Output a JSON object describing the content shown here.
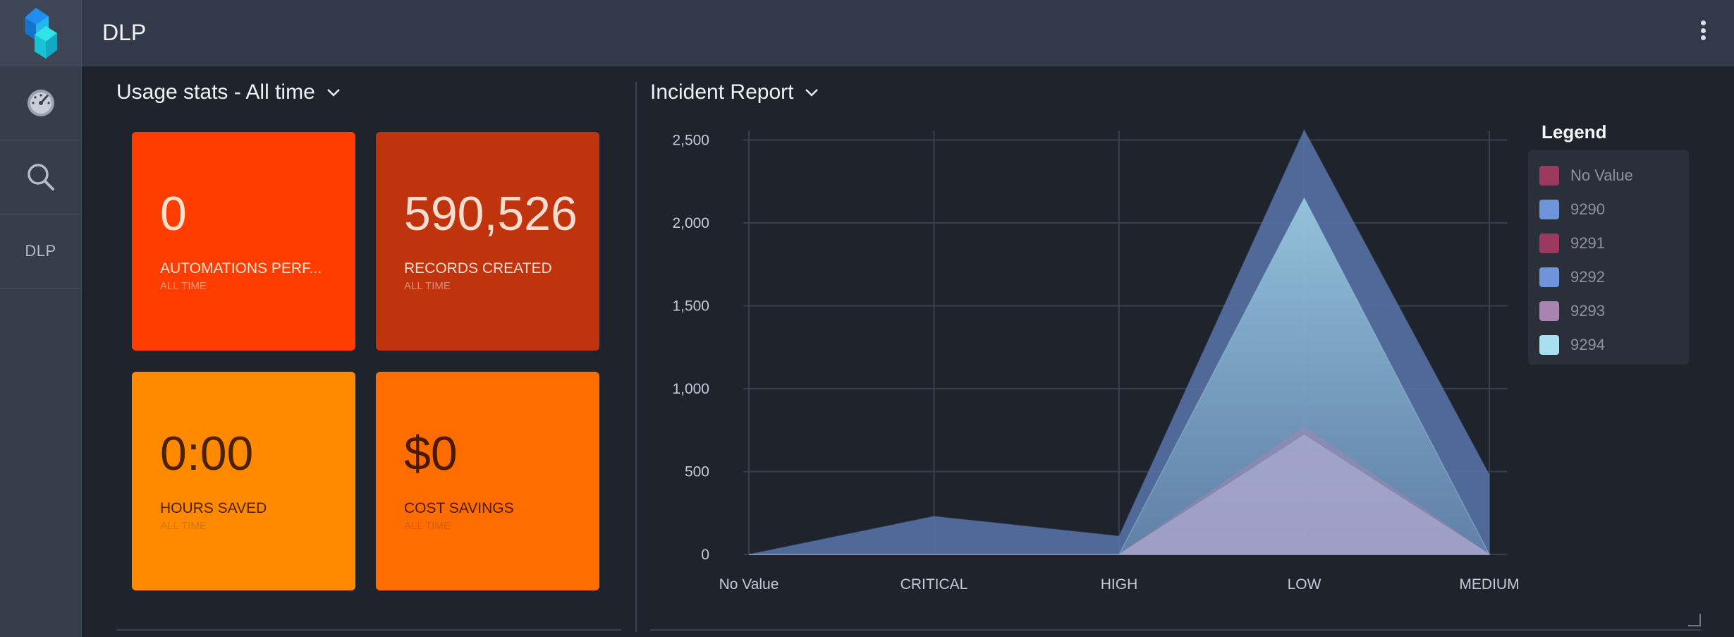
{
  "header": {
    "title": "DLP"
  },
  "sidebar": {
    "items": [
      {
        "icon": "dashboard-gauge-icon"
      },
      {
        "icon": "search-icon"
      },
      {
        "label": "DLP"
      }
    ]
  },
  "usage": {
    "title": "Usage stats - All time",
    "tiles": [
      {
        "value": "0",
        "label": "AUTOMATIONS PERF...",
        "sub": "ALL TIME",
        "color": "#ff3d00"
      },
      {
        "value": "590,526",
        "label": "RECORDS CREATED",
        "sub": "ALL TIME",
        "color": "#c0340d"
      },
      {
        "value": "0:00",
        "label": "HOURS SAVED",
        "sub": "ALL TIME",
        "color": "#ff8a00"
      },
      {
        "value": "$0",
        "label": "COST SAVINGS",
        "sub": "ALL TIME",
        "color": "#ff6d00"
      }
    ]
  },
  "incident": {
    "title": "Incident Report",
    "legend_title": "Legend",
    "legend": [
      {
        "label": "No Value",
        "color": "#9c3a5e"
      },
      {
        "label": "9290",
        "color": "#6e95dc"
      },
      {
        "label": "9291",
        "color": "#9c3a5e"
      },
      {
        "label": "9292",
        "color": "#6e95dc"
      },
      {
        "label": "9293",
        "color": "#a884b0"
      },
      {
        "label": "9294",
        "color": "#a9dff0"
      }
    ]
  },
  "chart_data": {
    "type": "area",
    "categories": [
      "No Value",
      "CRITICAL",
      "HIGH",
      "LOW",
      "MEDIUM"
    ],
    "y_ticks": [
      "0",
      "500",
      "1,000",
      "1,500",
      "2,000",
      "2,500"
    ],
    "ylim": [
      0,
      2600
    ],
    "grid": true,
    "legend_position": "right",
    "series": [
      {
        "name": "9290",
        "color": "#5a76ab",
        "opacity": 0.85,
        "values": [
          0,
          230,
          110,
          2560,
          480
        ]
      },
      {
        "name": "9294",
        "color": "#a9dff0",
        "opacity": 0.75,
        "values": [
          0,
          0,
          0,
          2150,
          0
        ]
      },
      {
        "name": "9293",
        "color": "#a884b0",
        "opacity": 0.45,
        "values": [
          0,
          0,
          0,
          770,
          0
        ]
      },
      {
        "name": "9292",
        "color": "#b5b8d8",
        "opacity": 0.55,
        "values": [
          0,
          0,
          0,
          720,
          0
        ]
      }
    ]
  }
}
